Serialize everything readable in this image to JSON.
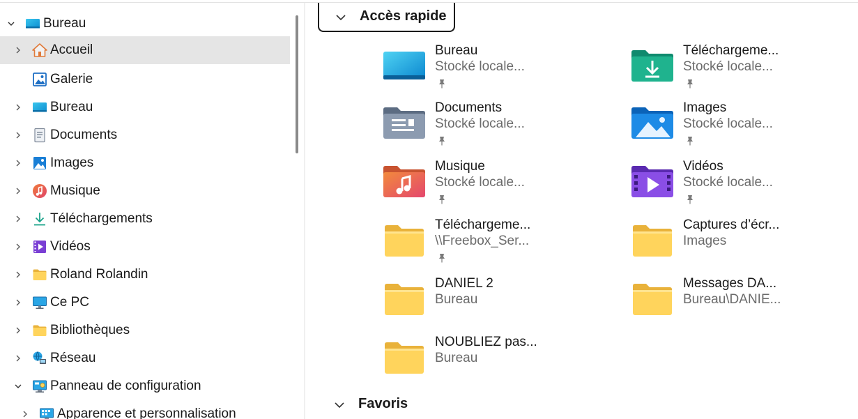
{
  "sidebar": {
    "items": [
      {
        "label": "Bureau",
        "chevron": "down",
        "icon": "desktop-icon",
        "level": 0
      },
      {
        "label": "Accueil",
        "chevron": "right",
        "icon": "home-icon",
        "level": 1,
        "selected": true
      },
      {
        "label": "Galerie",
        "chevron": "none",
        "icon": "gallery-icon",
        "level": 1
      },
      {
        "label": "Bureau",
        "chevron": "right",
        "icon": "desktop-icon",
        "level": 1
      },
      {
        "label": "Documents",
        "chevron": "right",
        "icon": "documents-icon",
        "level": 1
      },
      {
        "label": "Images",
        "chevron": "right",
        "icon": "images-icon",
        "level": 1
      },
      {
        "label": "Musique",
        "chevron": "right",
        "icon": "music-icon",
        "level": 1
      },
      {
        "label": "Téléchargements",
        "chevron": "right",
        "icon": "download-icon",
        "level": 1
      },
      {
        "label": "Vidéos",
        "chevron": "right",
        "icon": "videos-icon",
        "level": 1
      },
      {
        "label": "Roland Rolandin",
        "chevron": "right",
        "icon": "folder-icon",
        "level": 1
      },
      {
        "label": "Ce PC",
        "chevron": "right",
        "icon": "pc-icon",
        "level": 1
      },
      {
        "label": "Bibliothèques",
        "chevron": "right",
        "icon": "folder-icon",
        "level": 1
      },
      {
        "label": "Réseau",
        "chevron": "right",
        "icon": "network-icon",
        "level": 1
      },
      {
        "label": "Panneau de configuration",
        "chevron": "down",
        "icon": "control-panel-icon",
        "level": 1
      },
      {
        "label": "Apparence et personnalisation",
        "chevron": "right",
        "icon": "appearance-icon",
        "level": 2
      }
    ]
  },
  "main": {
    "quick_access": {
      "title": "Accès rapide",
      "tiles": [
        {
          "name": "Bureau",
          "sub": "Stocké locale...",
          "icon": "desktop-folder-icon",
          "pinned": true
        },
        {
          "name": "Téléchargeme...",
          "sub": "Stocké locale...",
          "icon": "downloads-folder-icon",
          "pinned": true
        },
        {
          "name": "Documents",
          "sub": "Stocké locale...",
          "icon": "documents-folder-icon",
          "pinned": true
        },
        {
          "name": "Images",
          "sub": "Stocké locale...",
          "icon": "pictures-folder-icon",
          "pinned": true
        },
        {
          "name": "Musique",
          "sub": "Stocké locale...",
          "icon": "music-folder-icon",
          "pinned": true
        },
        {
          "name": "Vidéos",
          "sub": "Stocké locale...",
          "icon": "videos-folder-icon",
          "pinned": true
        },
        {
          "name": "Téléchargeme...",
          "sub": "\\\\Freebox_Ser...",
          "icon": "folder-icon",
          "pinned": true
        },
        {
          "name": "Captures d’écr...",
          "sub": "Images",
          "icon": "folder-icon",
          "pinned": false
        },
        {
          "name": "DANIEL 2",
          "sub": "Bureau",
          "icon": "folder-icon",
          "pinned": false
        },
        {
          "name": "Messages DA...",
          "sub": "Bureau\\DANIE...",
          "icon": "folder-icon",
          "pinned": false
        },
        {
          "name": "NOUBLIEZ pas...",
          "sub": "Bureau",
          "icon": "folder-icon",
          "pinned": false
        }
      ]
    },
    "favorites": {
      "title": "Favoris"
    }
  },
  "colors": {
    "selection": "#e5e5e5",
    "folder_yellow": "#f8c845",
    "folder_yellow_light": "#ffe083",
    "accent_blue": "#1f8ee0"
  }
}
